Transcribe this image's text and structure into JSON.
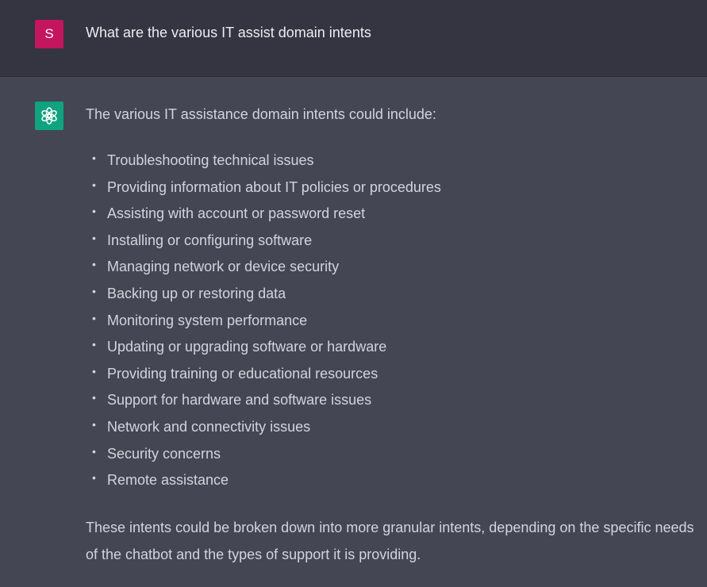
{
  "user": {
    "avatar_letter": "S",
    "avatar_color": "#c4155f",
    "message": "What are the various IT assist domain intents"
  },
  "assistant": {
    "avatar_icon": "openai-logo-icon",
    "avatar_color": "#10a37f",
    "intro": "The various IT assistance domain intents could include:",
    "intents": [
      "Troubleshooting technical issues",
      "Providing information about IT policies or procedures",
      "Assisting with account or password reset",
      "Installing or configuring software",
      "Managing network or device security",
      "Backing up or restoring data",
      "Monitoring system performance",
      "Updating or upgrading software or hardware",
      "Providing training or educational resources",
      "Support for hardware and software issues",
      "Network and connectivity issues",
      "Security concerns",
      "Remote assistance"
    ],
    "closing": "These intents could be broken down into more granular intents, depending on the specific needs of the chatbot and the types of support it is providing."
  },
  "colors": {
    "user_row_bg": "#343541",
    "assistant_row_bg": "#444654",
    "text": "#d1d5db"
  }
}
